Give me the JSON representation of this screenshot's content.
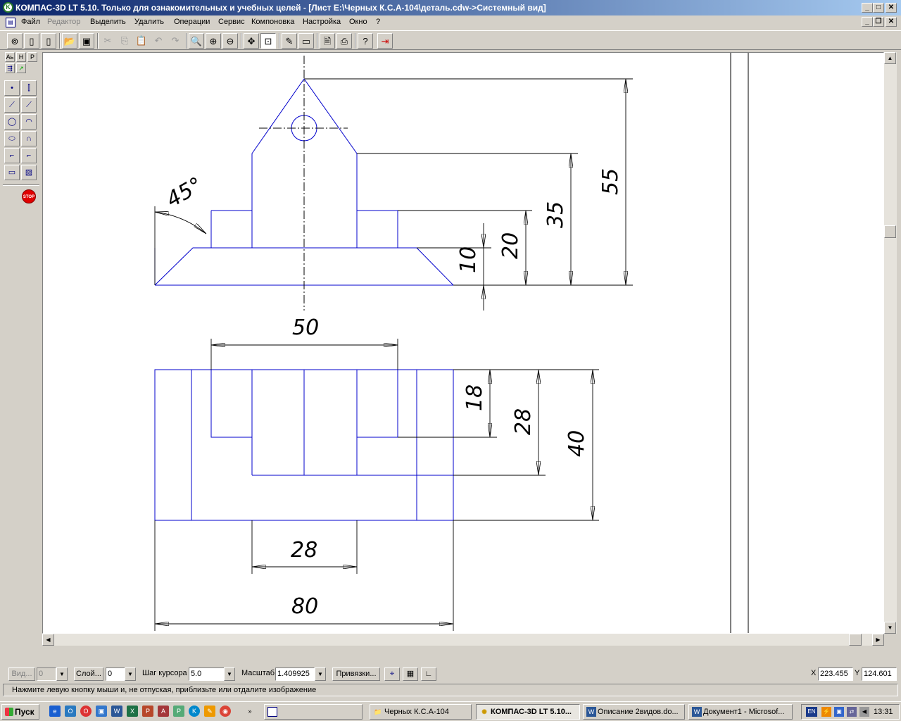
{
  "window": {
    "title": "КОМПАС-3D LT 5.10. Только для ознакомительных и учебных целей - [Лист E:\\Черных К.С.А-104\\деталь.cdw->Системный вид]",
    "controls": {
      "minimize": "_",
      "maximize": "□",
      "close": "✕",
      "restore": "❐"
    }
  },
  "menu": {
    "items": [
      "Файл",
      "Редактор",
      "Выделить",
      "Удалить",
      "Операции",
      "Сервис",
      "Компоновка",
      "Настройка",
      "Окно",
      "?"
    ],
    "disabled": [
      "Редактор"
    ]
  },
  "toolbar": {
    "icons": [
      "library-icon",
      "new-sheet-icon",
      "new-fragment-icon",
      "open-icon",
      "save-icon",
      "cut-icon",
      "copy-icon",
      "paste-icon",
      "undo-icon",
      "redo-icon",
      "zoom-icon",
      "zoom-in-icon",
      "zoom-out-icon",
      "pan-icon",
      "zoom-all-icon",
      "edit-icon",
      "frame-icon",
      "print-preview-icon",
      "print-icon",
      "help-icon",
      "exit-icon"
    ]
  },
  "left_tools": {
    "top_buttons": [
      "Аь",
      "H",
      "P"
    ],
    "stop_label": "STOP"
  },
  "drawing": {
    "dims": {
      "d55": "55",
      "d35": "35",
      "d20": "20",
      "d10": "10",
      "angle45": "45°",
      "d50": "50",
      "d18": "18",
      "d28v": "28",
      "d40": "40",
      "d28h": "28",
      "d80": "80"
    },
    "line_color": "#0000cc"
  },
  "status": {
    "view_label": "Вид...",
    "view_value": "0",
    "layer_label": "Слой...",
    "layer_value": "0",
    "step_label": "Шаг курсора",
    "step_value": "5.0",
    "scale_label": "Масштаб",
    "scale_value": "1.409925",
    "snaps_label": "Привязки...",
    "x_label": "X",
    "x_value": "223.455",
    "y_label": "Y",
    "y_value": "124.601",
    "hint": "Нажмите левую кнопку мыши и, не отпуская, приблизьте или отдалите изображение"
  },
  "taskbar": {
    "start_label": "Пуск",
    "tasks": [
      {
        "label": "Черных К.С.А-104",
        "icon": "folder-icon"
      },
      {
        "label": "КОМПАС-3D LT 5.10...",
        "icon": "kompas-icon",
        "active": true
      },
      {
        "label": "Описание 2видов.do...",
        "icon": "word-icon"
      },
      {
        "label": "Документ1 - Microsof...",
        "icon": "word-icon"
      }
    ],
    "lang": "EN",
    "clock": "13:31"
  }
}
